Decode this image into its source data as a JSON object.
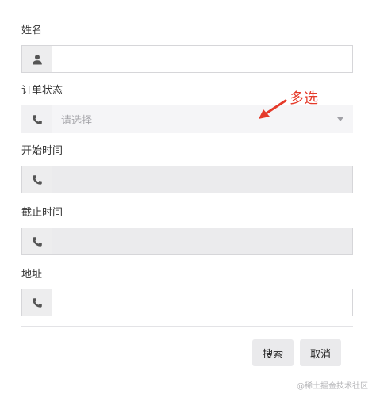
{
  "form": {
    "name": {
      "label": "姓名",
      "value": "",
      "icon": "user-icon"
    },
    "order_status": {
      "label": "订单状态",
      "placeholder": "请选择",
      "icon": "phone-icon"
    },
    "start_time": {
      "label": "开始时间",
      "value": "",
      "icon": "phone-icon"
    },
    "end_time": {
      "label": "截止时间",
      "value": "",
      "icon": "phone-icon"
    },
    "address": {
      "label": "地址",
      "value": "",
      "icon": "phone-icon"
    }
  },
  "buttons": {
    "search": "搜索",
    "cancel": "取消"
  },
  "annotation": {
    "text": "多选",
    "color": "#e53a2a"
  },
  "watermark": "@稀土掘金技术社区"
}
